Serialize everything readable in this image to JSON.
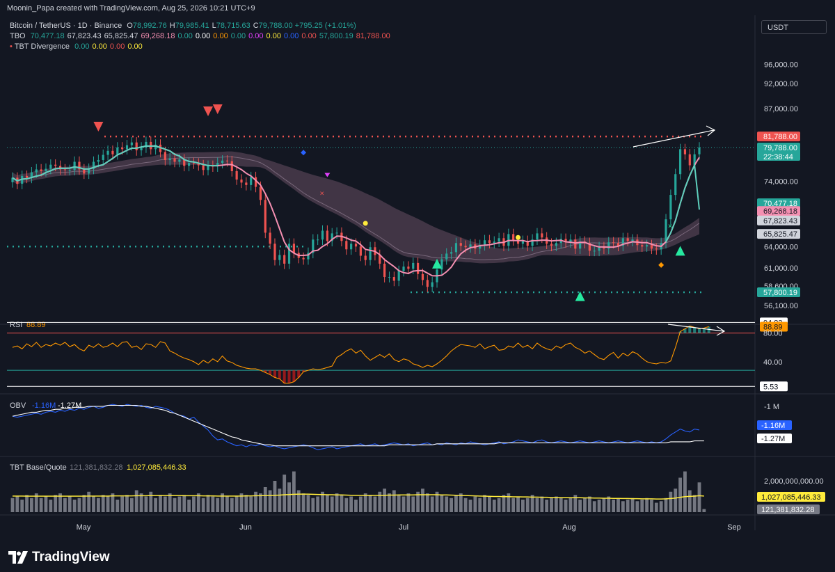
{
  "header": {
    "credit": "Moonin_Papa created with TradingView.com, Aug 25, 2026 10:21 UTC+9"
  },
  "currency_button": "USDT",
  "logo_text": "TradingView",
  "legend": {
    "symbol": "Bitcoin / TetherUS · 1D · Binance",
    "ohlc": [
      {
        "k": "O",
        "v": "78,992.76"
      },
      {
        "k": "H",
        "v": "79,985.41"
      },
      {
        "k": "L",
        "v": "78,715.63"
      },
      {
        "k": "C",
        "v": "79,788.00"
      }
    ],
    "change": "+795.25 (+1.01%)",
    "tbo_label": "TBO",
    "tbo_values": [
      {
        "v": "70,477.18",
        "c": "#26a69a"
      },
      {
        "v": "67,823.43",
        "c": "#d1d4dc"
      },
      {
        "v": "65,825.47",
        "c": "#d1d4dc"
      },
      {
        "v": "69,268.18",
        "c": "#f48fb1"
      },
      {
        "v": "0.00",
        "c": "#26a69a"
      },
      {
        "v": "0.00",
        "c": "#ffffff"
      },
      {
        "v": "0.00",
        "c": "#ff9800"
      },
      {
        "v": "0.00",
        "c": "#26a69a"
      },
      {
        "v": "0.00",
        "c": "#e040fb"
      },
      {
        "v": "0.00",
        "c": "#ffeb3b"
      },
      {
        "v": "0.00",
        "c": "#2962ff"
      },
      {
        "v": "0.00",
        "c": "#ef5350"
      },
      {
        "v": "57,800.19",
        "c": "#26a69a"
      },
      {
        "v": "81,788.00",
        "c": "#ef5350"
      }
    ],
    "div_label": "TBT Divergence",
    "div_values": [
      {
        "v": "0.00",
        "c": "#26a69a"
      },
      {
        "v": "0.00",
        "c": "#ffeb3b"
      },
      {
        "v": "0.00",
        "c": "#ef5350"
      },
      {
        "v": "0.00",
        "c": "#ffeb3b"
      }
    ]
  },
  "colors": {
    "up": "#26a69a",
    "down": "#ef5350",
    "bg": "#131722",
    "grid": "#1e222d",
    "text": "#d1d4dc",
    "rsi": "#ff9800",
    "obv": "#2962ff",
    "vol": "#787b86",
    "volma": "#ffeb3b"
  },
  "chart_data": [
    {
      "type": "candlestick",
      "title": "Bitcoin / TetherUS · 1D · Binance",
      "x_ticks": [
        "May",
        "Jun",
        "Jul",
        "Aug",
        "Sep"
      ],
      "y_ticks": [
        96000,
        92000,
        87000,
        74000,
        64000,
        61000,
        58600,
        56100
      ],
      "y_tick_labels": [
        "96,000.00",
        "92,000.00",
        "87,000.00",
        "74,000.00",
        "64,000.00",
        "61,000.00",
        "58,600.00",
        "56,100.00"
      ],
      "scale": "log",
      "ylim": [
        55000,
        101000
      ],
      "candles_close": [
        74600,
        73600,
        74900,
        74600,
        75500,
        76000,
        75700,
        76100,
        76800,
        76600,
        76000,
        75900,
        75900,
        77300,
        76000,
        75300,
        76100,
        77300,
        77600,
        78500,
        79200,
        78600,
        79800,
        79500,
        80200,
        80700,
        79300,
        79800,
        80800,
        79500,
        80300,
        79000,
        77600,
        77900,
        77300,
        77700,
        76600,
        77100,
        77000,
        76700,
        75900,
        76600,
        76500,
        77100,
        77500,
        77400,
        75700,
        74300,
        73800,
        73400,
        74700,
        73100,
        71000,
        66000,
        64400,
        62100,
        62800,
        61600,
        64400,
        63100,
        62400,
        62200,
        63100,
        65000,
        65000,
        66300,
        64800,
        65900,
        66000,
        64800,
        63600,
        64400,
        64000,
        62700,
        62100,
        63900,
        62800,
        61600,
        59800,
        59800,
        59300,
        60600,
        61200,
        60900,
        61700,
        60200,
        59400,
        58500,
        59100,
        60800,
        62200,
        63000,
        63200,
        64500,
        64100,
        63900,
        64300,
        63700,
        64200,
        64900,
        64500,
        64700,
        65200,
        64100,
        65800,
        64900,
        64400,
        64800,
        64100,
        65000,
        65900,
        65300,
        64400,
        64100,
        64500,
        65100,
        64600,
        65000,
        63700,
        64700,
        64500,
        63400,
        63400,
        63900,
        63700,
        64600,
        64500,
        64100,
        65200,
        64800,
        65000,
        64200,
        64000,
        64200,
        63700,
        63600,
        64500,
        68000,
        71800,
        75200,
        79500,
        78600,
        76700,
        78600,
        79800
      ],
      "series": [
        {
          "name": "TBO",
          "values": "70,477.18"
        },
        {
          "name": "TBO",
          "values": "69,268.18"
        },
        {
          "name": "TBO",
          "values": "67,823.43"
        },
        {
          "name": "TBO",
          "values": "65,825.47"
        },
        {
          "name": "TBO",
          "values": "57,800.19"
        },
        {
          "name": "TBO",
          "values": "81,788.00"
        }
      ],
      "price_labels": [
        {
          "v": "81,788.00",
          "bg": "#ef5350",
          "fg": "#ffffff",
          "price": 81788
        },
        {
          "v": "79,788.00",
          "bg": "#26a69a",
          "fg": "#ffffff",
          "price": 79788,
          "extra": "22:38:44"
        },
        {
          "v": "70,477.18",
          "bg": "#26a69a",
          "fg": "#ffffff",
          "price": 70477
        },
        {
          "v": "69,268.18",
          "bg": "#f48fb1",
          "fg": "#131722",
          "price": 69268
        },
        {
          "v": "67,823.43",
          "bg": "#d1d4dc",
          "fg": "#131722",
          "price": 67823
        },
        {
          "v": "65,825.47",
          "bg": "#d1d4dc",
          "fg": "#131722",
          "price": 65825
        },
        {
          "v": "57,800.19",
          "bg": "#26a69a",
          "fg": "#ffffff",
          "price": 57800
        }
      ],
      "resistance": 81788,
      "support": [
        64000,
        57800
      ],
      "grid": false,
      "legend": "top-left"
    },
    {
      "type": "line",
      "title": "RSI",
      "value_label": "88.89",
      "levels": [
        80,
        40
      ],
      "y_tick_labels": [
        "94.83",
        "80.00",
        "40.00",
        "5.53"
      ],
      "ylim": [
        0,
        100
      ],
      "values": [
        60,
        62,
        58,
        65,
        61,
        67,
        60,
        64,
        62,
        66,
        63,
        67,
        61,
        64,
        58,
        55,
        63,
        60,
        65,
        60,
        62,
        66,
        61,
        67,
        68,
        60,
        62,
        57,
        65,
        64,
        60,
        68,
        66,
        55,
        52,
        48,
        45,
        43,
        40,
        36,
        42,
        38,
        44,
        40,
        48,
        41,
        39,
        35,
        33,
        31,
        30,
        30,
        28,
        25,
        22,
        18,
        16,
        10,
        10,
        12,
        18,
        26,
        28,
        30,
        29,
        30,
        32,
        34,
        46,
        50,
        55,
        58,
        52,
        56,
        48,
        42,
        46,
        50,
        46,
        51,
        43,
        40,
        44,
        42,
        37,
        35,
        32,
        35,
        33,
        37,
        42,
        48,
        55,
        60,
        64,
        63,
        62,
        60,
        65,
        58,
        61,
        63,
        56,
        57,
        62,
        60,
        66,
        60,
        63,
        58,
        66,
        61,
        58,
        56,
        62,
        59,
        64,
        66,
        60,
        57,
        52,
        55,
        50,
        45,
        43,
        49,
        53,
        45,
        52,
        48,
        54,
        51,
        45,
        40,
        38,
        37,
        39,
        38,
        41,
        60,
        82,
        86,
        90,
        88,
        86,
        87,
        89
      ],
      "divergence_arrow": true
    },
    {
      "type": "line",
      "title": "OBV",
      "series": [
        {
          "name": "OBV",
          "values_label": "-1.16M"
        },
        {
          "name": "OBV",
          "values_label": "-1.27M"
        }
      ],
      "y_tick_labels": [
        "-1 M"
      ],
      "obv": [
        -1.02,
        -1.03,
        -1.02,
        -1.01,
        -1.0,
        -0.99,
        -1.0,
        -0.98,
        -0.97,
        -0.98,
        -0.96,
        -0.97,
        -0.95,
        -0.96,
        -0.94,
        -0.95,
        -0.93,
        -0.92,
        -0.94,
        -0.93,
        -0.91,
        -0.9,
        -0.91,
        -0.92,
        -0.9,
        -0.91,
        -0.92,
        -0.91,
        -0.93,
        -0.94,
        -0.92,
        -0.93,
        -0.94,
        -0.96,
        -0.99,
        -1.01,
        -1.02,
        -1.05,
        -1.03,
        -1.08,
        -1.12,
        -1.16,
        -1.22,
        -1.26,
        -1.25,
        -1.28,
        -1.3,
        -1.32,
        -1.31,
        -1.33,
        -1.31,
        -1.32,
        -1.3,
        -1.32,
        -1.33,
        -1.32,
        -1.34,
        -1.35,
        -1.34,
        -1.33,
        -1.32,
        -1.31,
        -1.32,
        -1.34,
        -1.36,
        -1.35,
        -1.34,
        -1.33,
        -1.35,
        -1.34,
        -1.33,
        -1.32,
        -1.31,
        -1.3,
        -1.32,
        -1.31,
        -1.3,
        -1.32,
        -1.31,
        -1.3,
        -1.29,
        -1.3,
        -1.31,
        -1.3,
        -1.32,
        -1.31,
        -1.3,
        -1.29,
        -1.31,
        -1.3,
        -1.31,
        -1.29,
        -1.3,
        -1.31,
        -1.29,
        -1.3,
        -1.28,
        -1.29,
        -1.3,
        -1.31,
        -1.3,
        -1.29,
        -1.28,
        -1.3,
        -1.29,
        -1.28,
        -1.26,
        -1.27,
        -1.28,
        -1.29,
        -1.27,
        -1.26,
        -1.28,
        -1.29,
        -1.28,
        -1.27,
        -1.28,
        -1.29,
        -1.28,
        -1.27,
        -1.28,
        -1.29,
        -1.28,
        -1.27,
        -1.28,
        -1.29,
        -1.28,
        -1.27,
        -1.28,
        -1.29,
        -1.28,
        -1.27,
        -1.28,
        -1.29,
        -1.28,
        -1.29,
        -1.28,
        -1.25,
        -1.21,
        -1.18,
        -1.15,
        -1.17,
        -1.18,
        -1.15,
        -1.16
      ],
      "obv_ma": [
        -1.02,
        -1.01,
        -1.0,
        -0.99,
        -0.98,
        -0.98,
        -0.97,
        -0.96,
        -0.96,
        -0.95,
        -0.95,
        -0.94,
        -0.94,
        -0.93,
        -0.93,
        -0.93,
        -0.92,
        -0.92,
        -0.92,
        -0.92,
        -0.91,
        -0.91,
        -0.91,
        -0.91,
        -0.91,
        -0.91,
        -0.91,
        -0.92,
        -0.92,
        -0.93,
        -0.94,
        -0.95,
        -0.96,
        -0.98,
        -0.99,
        -1.01,
        -1.03,
        -1.05,
        -1.07,
        -1.09,
        -1.11,
        -1.13,
        -1.15,
        -1.17,
        -1.19,
        -1.21,
        -1.23,
        -1.24,
        -1.26,
        -1.27,
        -1.28,
        -1.29,
        -1.3,
        -1.31,
        -1.31,
        -1.32,
        -1.32,
        -1.32,
        -1.32,
        -1.32,
        -1.32,
        -1.32,
        -1.32,
        -1.32,
        -1.32,
        -1.32,
        -1.32,
        -1.32,
        -1.32,
        -1.32,
        -1.32,
        -1.32,
        -1.32,
        -1.32,
        -1.32,
        -1.32,
        -1.32,
        -1.32,
        -1.32,
        -1.31,
        -1.31,
        -1.31,
        -1.31,
        -1.31,
        -1.31,
        -1.31,
        -1.31,
        -1.31,
        -1.31,
        -1.3,
        -1.3,
        -1.3,
        -1.3,
        -1.3,
        -1.3,
        -1.3,
        -1.3,
        -1.3,
        -1.3,
        -1.3,
        -1.3,
        -1.3,
        -1.29,
        -1.29,
        -1.29,
        -1.29,
        -1.29,
        -1.29,
        -1.29,
        -1.29,
        -1.29,
        -1.29,
        -1.29,
        -1.29,
        -1.29,
        -1.29,
        -1.29,
        -1.29,
        -1.29,
        -1.29,
        -1.29,
        -1.29,
        -1.29,
        -1.29,
        -1.29,
        -1.29,
        -1.29,
        -1.29,
        -1.29,
        -1.29,
        -1.29,
        -1.29,
        -1.29,
        -1.29,
        -1.29,
        -1.29,
        -1.29,
        -1.29,
        -1.28,
        -1.28,
        -1.28,
        -1.28,
        -1.28,
        -1.27,
        -1.27,
        -1.27
      ]
    },
    {
      "type": "bar",
      "title": "TBT Base/Quote",
      "legend_values": [
        "121,381,832.28",
        "1,027,085,446.33"
      ],
      "y_tick_labels": [
        "2,000,000,000.00"
      ],
      "price_labels": [
        {
          "v": "1,027,085,446.33",
          "bg": "#ffeb3b",
          "fg": "#131722"
        },
        {
          "v": "121,381,832.28",
          "bg": "#787b86",
          "fg": "#ffffff"
        }
      ],
      "values": [
        0.9,
        1.0,
        0.8,
        1.1,
        0.9,
        1.2,
        0.9,
        1.0,
        0.8,
        1.1,
        1.2,
        0.9,
        1.0,
        0.8,
        0.9,
        1.1,
        1.3,
        1.0,
        0.9,
        1.1,
        1.0,
        1.2,
        0.8,
        1.0,
        1.1,
        0.9,
        1.4,
        1.2,
        1.0,
        1.3,
        0.9,
        1.1,
        1.0,
        1.2,
        0.9,
        1.0,
        1.1,
        0.8,
        1.0,
        1.2,
        0.9,
        1.1,
        1.0,
        0.9,
        1.2,
        1.0,
        0.9,
        1.0,
        1.2,
        1.1,
        1.0,
        1.3,
        1.2,
        1.6,
        1.4,
        2.0,
        1.5,
        2.4,
        1.9,
        2.6,
        1.4,
        1.2,
        1.1,
        0.9,
        1.0,
        1.3,
        1.1,
        1.0,
        1.2,
        1.1,
        0.9,
        1.0,
        0.8,
        1.0,
        1.2,
        1.1,
        1.0,
        1.3,
        1.5,
        1.2,
        1.4,
        1.1,
        1.0,
        1.2,
        1.0,
        1.3,
        1.5,
        1.2,
        1.0,
        1.3,
        1.1,
        1.0,
        0.9,
        1.1,
        1.2,
        0.9,
        0.8,
        1.0,
        0.9,
        1.1,
        1.0,
        0.8,
        0.9,
        1.1,
        1.2,
        0.9,
        1.0,
        0.8,
        0.9,
        1.1,
        0.9,
        1.0,
        0.8,
        0.9,
        1.0,
        0.9,
        0.8,
        0.9,
        1.1,
        0.8,
        0.9,
        1.0,
        0.7,
        0.8,
        0.9,
        1.0,
        0.8,
        0.9,
        0.7,
        0.8,
        0.9,
        0.7,
        0.8,
        0.9,
        0.8,
        0.6,
        0.7,
        0.9,
        1.3,
        1.5,
        2.2,
        2.6,
        1.4,
        1.1,
        1.9,
        0.2
      ],
      "volume_ma": [
        1.03,
        1.03,
        1.03,
        1.02,
        1.02,
        1.02,
        1.02,
        1.02,
        1.02,
        1.02,
        1.02,
        1.02,
        1.02,
        1.02,
        1.02,
        1.02,
        1.03,
        1.03,
        1.03,
        1.03,
        1.03,
        1.04,
        1.04,
        1.04,
        1.04,
        1.04,
        1.05,
        1.05,
        1.05,
        1.06,
        1.06,
        1.06,
        1.06,
        1.06,
        1.06,
        1.06,
        1.05,
        1.05,
        1.05,
        1.05,
        1.04,
        1.04,
        1.04,
        1.03,
        1.03,
        1.03,
        1.03,
        1.03,
        1.03,
        1.04,
        1.04,
        1.05,
        1.05,
        1.06,
        1.07,
        1.08,
        1.09,
        1.11,
        1.12,
        1.14,
        1.15,
        1.15,
        1.15,
        1.14,
        1.13,
        1.12,
        1.11,
        1.11,
        1.1,
        1.1,
        1.09,
        1.08,
        1.08,
        1.07,
        1.07,
        1.07,
        1.07,
        1.08,
        1.08,
        1.09,
        1.09,
        1.1,
        1.1,
        1.1,
        1.1,
        1.11,
        1.11,
        1.11,
        1.11,
        1.11,
        1.1,
        1.1,
        1.09,
        1.08,
        1.07,
        1.06,
        1.05,
        1.04,
        1.03,
        1.02,
        1.01,
        1.0,
        1.0,
        0.99,
        0.99,
        0.98,
        0.98,
        0.97,
        0.97,
        0.96,
        0.96,
        0.95,
        0.95,
        0.94,
        0.94,
        0.93,
        0.93,
        0.92,
        0.92,
        0.92,
        0.91,
        0.91,
        0.9,
        0.9,
        0.89,
        0.89,
        0.88,
        0.88,
        0.87,
        0.87,
        0.86,
        0.86,
        0.85,
        0.85,
        0.85,
        0.84,
        0.84,
        0.85,
        0.87,
        0.9,
        0.95,
        0.99,
        1.01,
        1.02,
        1.05,
        1.03
      ],
      "ylim": [
        0,
        3.2
      ]
    }
  ]
}
